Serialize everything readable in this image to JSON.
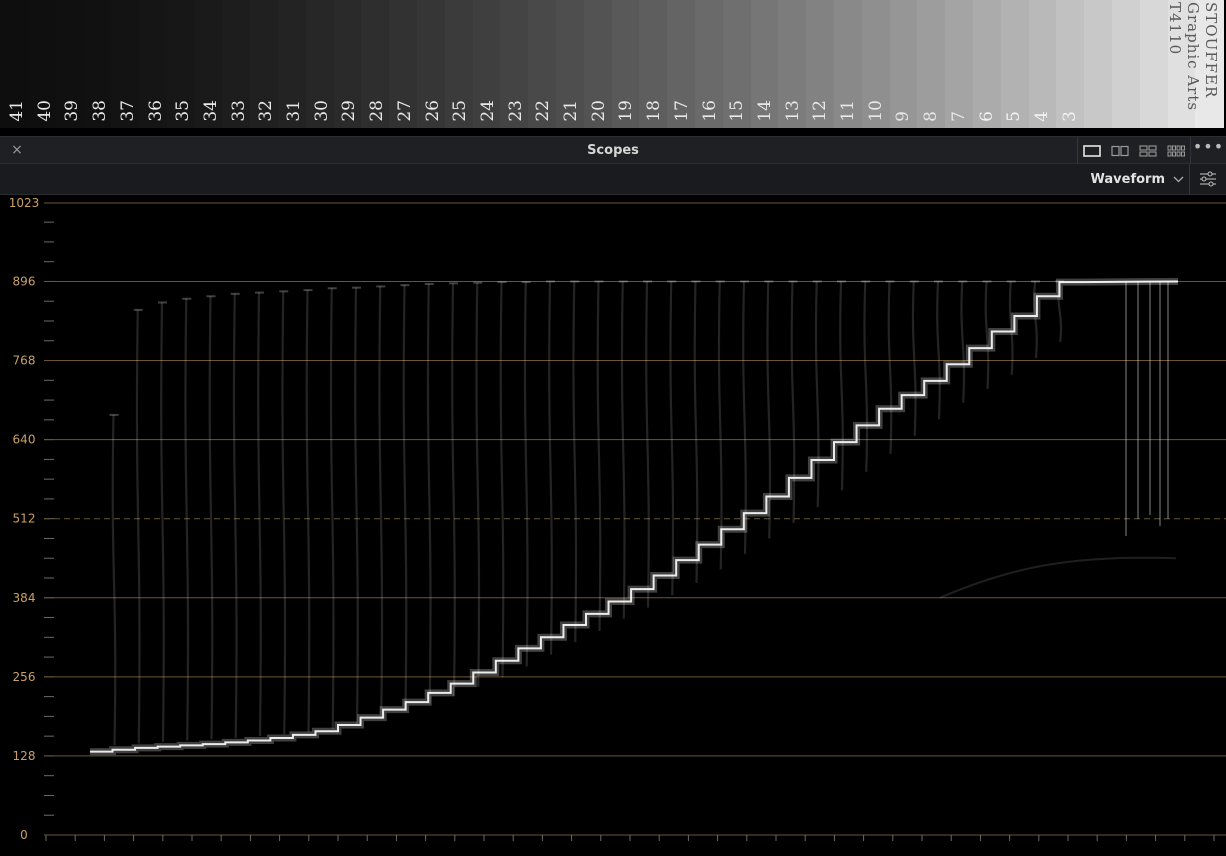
{
  "wedge": {
    "step_numbers": [
      "41",
      "40",
      "39",
      "38",
      "37",
      "36",
      "35",
      "34",
      "33",
      "32",
      "31",
      "30",
      "29",
      "28",
      "27",
      "26",
      "25",
      "24",
      "23",
      "22",
      "21",
      "20",
      "19",
      "18",
      "17",
      "16",
      "15",
      "14",
      "13",
      "12",
      "11",
      "10",
      "9",
      "8",
      "7",
      "6",
      "5",
      "4",
      "3"
    ],
    "brand_lines": [
      "STOUFFER",
      "Graphic Arts",
      "T4110"
    ]
  },
  "panel": {
    "title": "Scopes",
    "close_glyph": "×",
    "more_glyph": "•••",
    "layout_options": [
      "single-view-icon",
      "dual-view-icon",
      "quad-view-icon",
      "grid-view-icon"
    ],
    "active_layout": "single-view-icon"
  },
  "toolbar": {
    "scope_type": "Waveform",
    "settings_icon": "sliders-icon"
  },
  "colors": {
    "panel_bg": "#1f2023",
    "toolbar_bg": "#1a1b1e",
    "graticule": "#6b5533",
    "axis_label": "#c9a064",
    "trace": "#ffffff"
  },
  "chart_data": {
    "type": "line",
    "y_axis_labels": [
      "1023",
      "896",
      "768",
      "640",
      "512",
      "384",
      "256",
      "128",
      "0"
    ],
    "ylim": [
      0,
      1023
    ],
    "gridlines": [
      1023,
      896,
      768,
      640,
      512,
      384,
      256,
      128,
      0
    ],
    "dashed_gridline": 512,
    "series": [
      {
        "values": [
          135,
          138,
          141,
          143,
          145,
          147,
          150,
          153,
          157,
          162,
          168,
          178,
          190,
          203,
          215,
          230,
          245,
          263,
          282,
          302,
          320,
          340,
          358,
          378,
          398,
          420,
          445,
          470,
          495,
          521,
          548,
          578,
          607,
          636,
          663,
          690,
          712,
          735,
          762,
          788,
          815,
          840,
          872,
          895
        ]
      }
    ],
    "upper_trace": [
      680,
      850,
      862,
      868,
      872,
      876,
      878,
      880,
      882,
      885,
      886,
      888,
      890,
      892,
      893,
      894,
      895,
      895,
      896,
      896,
      896,
      896,
      896,
      896,
      896,
      896,
      896,
      896,
      896,
      896,
      896,
      896,
      896,
      896,
      896,
      896,
      896,
      896,
      896,
      896
    ]
  }
}
